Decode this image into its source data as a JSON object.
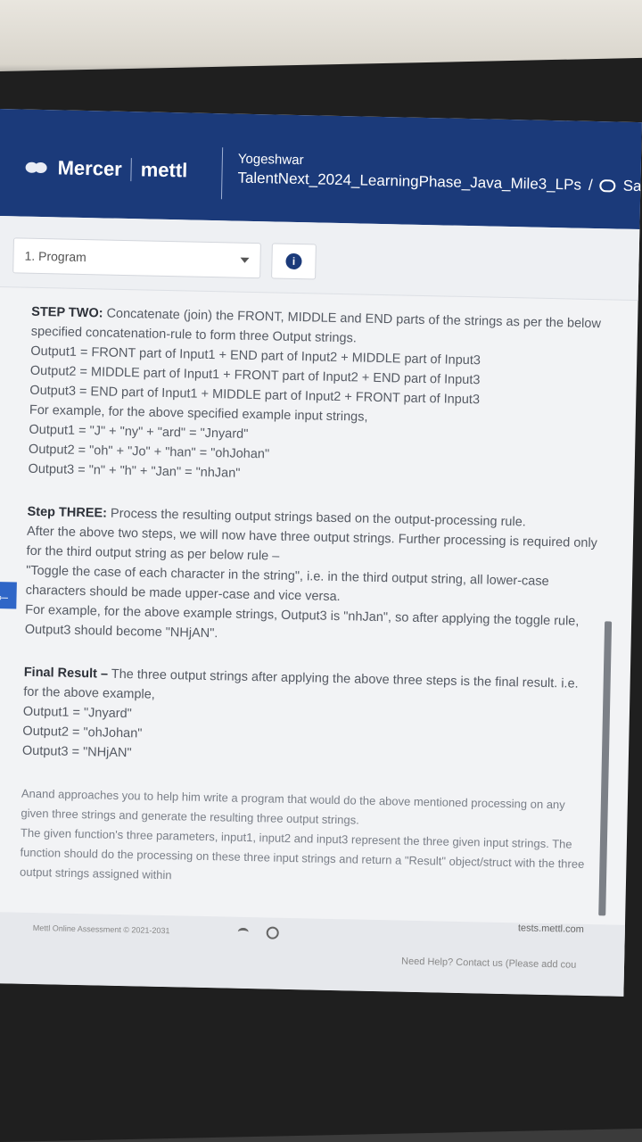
{
  "header": {
    "brand": "Mercer",
    "product": "mettl",
    "user_name": "Yogeshwar",
    "course_title": "TalentNext_2024_LearningPhase_Java_Mile3_LPs",
    "breadcrumb_sep": "/",
    "save_label": "Save"
  },
  "toolbar": {
    "question_select": "1. Program"
  },
  "content": {
    "step_two": {
      "label": "STEP TWO:",
      "text": "Concatenate (join) the FRONT, MIDDLE and END parts of the strings as per the below specified concatenation-rule to form three Output strings.",
      "lines": [
        "Output1 = FRONT part of Input1 + END part of Input2 + MIDDLE part of Input3",
        "Output2 = MIDDLE part of Input1 + FRONT part of Input2 + END part of Input3",
        "Output3 = END part of Input1 + MIDDLE part of Input2 + FRONT part of Input3",
        "For example, for the above specified example input strings,",
        "Output1 = \"J\" + \"ny\" + \"ard\" = \"Jnyard\"",
        "Output2 = \"oh\" + \"Jo\" + \"han\" = \"ohJohan\"",
        "Output3 = \"n\" + \"h\" + \"Jan\" = \"nhJan\""
      ]
    },
    "step_three": {
      "label": "Step THREE:",
      "text": "Process the resulting output strings based on the output-processing rule.",
      "lines": [
        "After the above two steps, we will now have three output strings. Further processing is required only for the third output string as per below rule –",
        "\"Toggle the case of each character in the string\", i.e. in the third output string, all lower-case characters should be made upper-case and vice versa.",
        "For example, for the above example strings, Output3 is \"nhJan\", so after applying the toggle rule, Output3 should become \"NHjAN\"."
      ]
    },
    "final_result": {
      "label": "Final Result –",
      "text": "The three output strings after applying the above three steps is the final result. i.e. for the above example,",
      "lines": [
        "Output1 = \"Jnyard\"",
        "Output2 = \"ohJohan\"",
        "Output3 = \"NHjAN\""
      ]
    },
    "closing": [
      "Anand approaches you to help him write a program that would do the above mentioned processing on any given three strings and generate the resulting three output strings.",
      "The given function's three parameters, input1, input2 and input3 represent the three given input strings. The function should do the processing on these three input strings and return a \"Result\" object/struct with the three output strings assigned within"
    ]
  },
  "footer": {
    "copyright": "Mettl Online Assessment © 2021-2031",
    "help": "Need Help? Contact us (Please add cou",
    "domain": "tests.mettl.com"
  }
}
